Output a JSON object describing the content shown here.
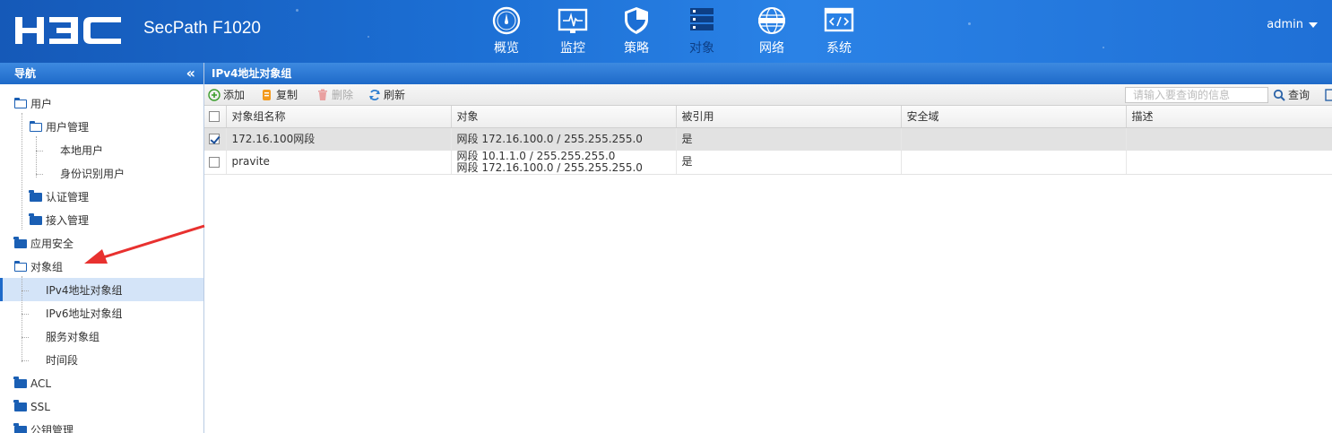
{
  "header": {
    "logo_text": "H3C",
    "product": "SecPath F1020",
    "nav": [
      {
        "label": "概览",
        "icon": "dashboard-icon"
      },
      {
        "label": "监控",
        "icon": "monitor-icon"
      },
      {
        "label": "策略",
        "icon": "shield-icon"
      },
      {
        "label": "对象",
        "icon": "server-stack-icon"
      },
      {
        "label": "网络",
        "icon": "internet-globe-icon"
      },
      {
        "label": "系统",
        "icon": "code-window-icon"
      }
    ],
    "user": "admin"
  },
  "sidebar": {
    "title": "导航",
    "collapse_glyph": "«",
    "items": [
      {
        "label": "用户"
      },
      {
        "label": "用户管理"
      },
      {
        "label": "本地用户"
      },
      {
        "label": "身份识别用户"
      },
      {
        "label": "认证管理"
      },
      {
        "label": "接入管理"
      },
      {
        "label": "应用安全"
      },
      {
        "label": "对象组"
      },
      {
        "label": "IPv4地址对象组"
      },
      {
        "label": "IPv6地址对象组"
      },
      {
        "label": "服务对象组"
      },
      {
        "label": "时间段"
      },
      {
        "label": "ACL"
      },
      {
        "label": "SSL"
      },
      {
        "label": "公钥管理"
      }
    ]
  },
  "main": {
    "title": "IPv4地址对象组",
    "toolbar": {
      "add": "添加",
      "copy": "复制",
      "delete": "删除",
      "refresh": "刷新",
      "search_placeholder": "请输入要查询的信息",
      "search": "查询"
    },
    "table": {
      "columns": [
        "对象组名称",
        "对象",
        "被引用",
        "安全域",
        "描述"
      ],
      "rows": [
        {
          "checked": true,
          "name": "172.16.100网段",
          "objects": [
            "网段 172.16.100.0 / 255.255.255.0"
          ],
          "referenced": "是",
          "zone": "",
          "desc": ""
        },
        {
          "checked": false,
          "name": "pravite",
          "objects": [
            "网段 10.1.1.0 / 255.255.255.0",
            "网段 172.16.100.0 / 255.255.255.0"
          ],
          "referenced": "是",
          "zone": "",
          "desc": ""
        }
      ]
    }
  },
  "colors": {
    "header_blue": "#1c6fd4",
    "panel_blue": "#1e6ac9",
    "folder_blue": "#1a5fb4",
    "selection": "#d4e4f8",
    "annotation_arrow": "#e8312f"
  }
}
